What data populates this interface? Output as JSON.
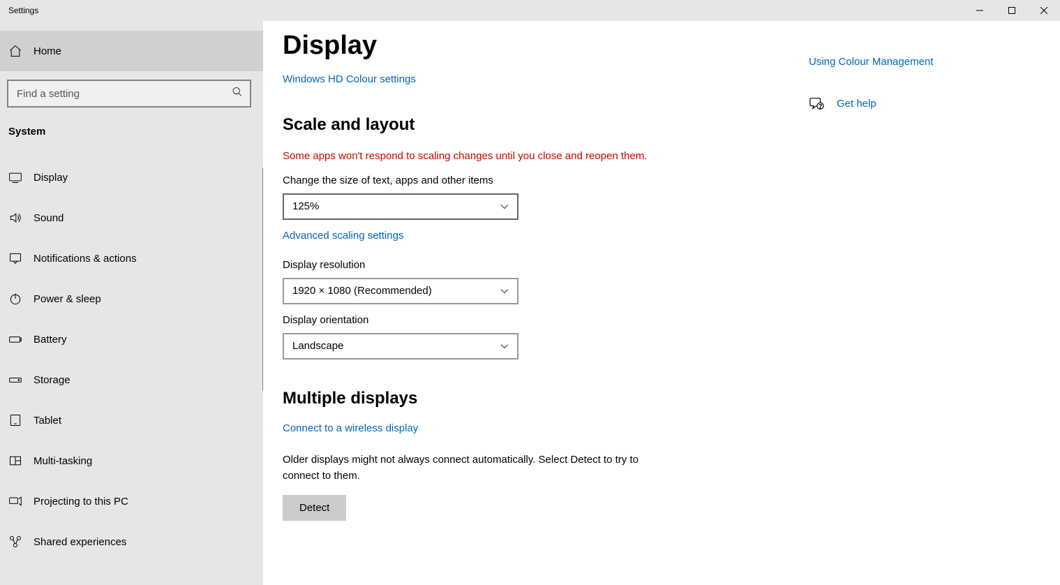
{
  "titlebar": {
    "title": "Settings"
  },
  "sidebar": {
    "home_label": "Home",
    "search_placeholder": "Find a setting",
    "section_header": "System",
    "items": [
      {
        "label": "Display"
      },
      {
        "label": "Sound"
      },
      {
        "label": "Notifications & actions"
      },
      {
        "label": "Power & sleep"
      },
      {
        "label": "Battery"
      },
      {
        "label": "Storage"
      },
      {
        "label": "Tablet"
      },
      {
        "label": "Multi-tasking"
      },
      {
        "label": "Projecting to this PC"
      },
      {
        "label": "Shared experiences"
      }
    ]
  },
  "main": {
    "page_title": "Display",
    "hd_link": "Windows HD Colour settings",
    "scale_heading": "Scale and layout",
    "scale_warning": "Some apps won't respond to scaling changes until you close and reopen them.",
    "scale_label": "Change the size of text, apps and other items",
    "scale_value": "125%",
    "advanced_link": "Advanced scaling settings",
    "resolution_label": "Display resolution",
    "resolution_value": "1920 × 1080 (Recommended)",
    "orientation_label": "Display orientation",
    "orientation_value": "Landscape",
    "multi_heading": "Multiple displays",
    "wireless_link": "Connect to a wireless display",
    "detect_text": "Older displays might not always connect automatically. Select Detect to try to connect to them.",
    "detect_btn": "Detect"
  },
  "side": {
    "colour_link": "Using Colour Management",
    "help_label": "Get help"
  }
}
